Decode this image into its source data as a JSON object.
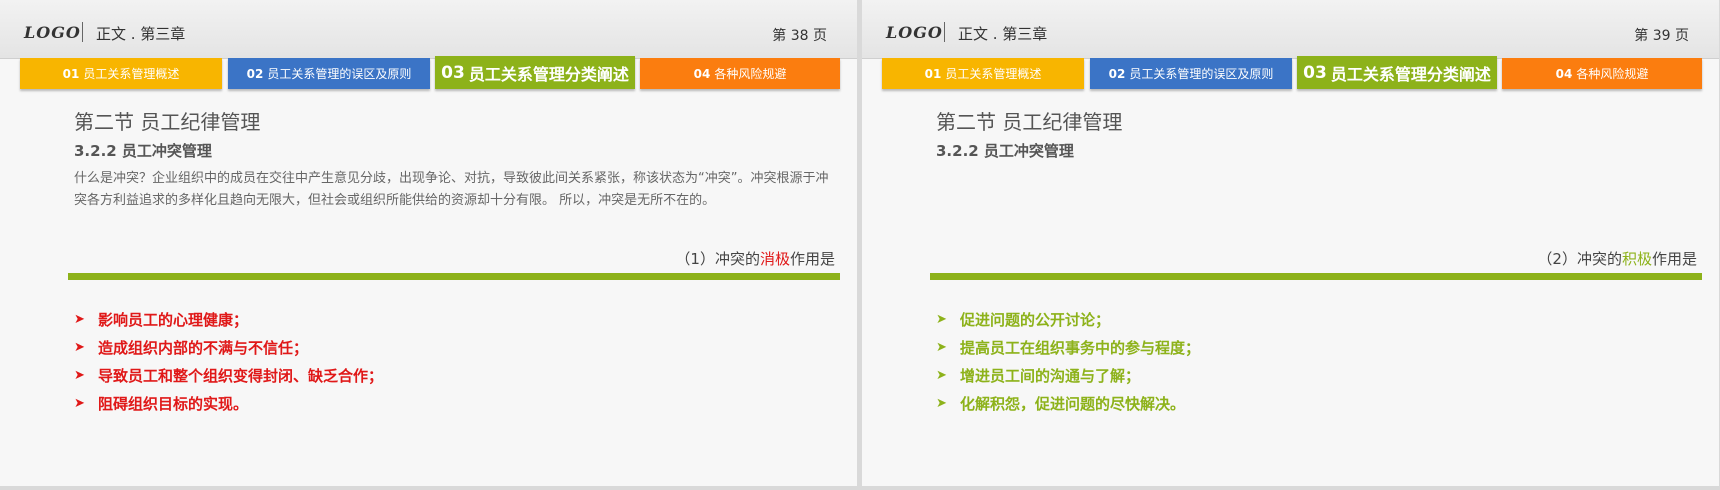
{
  "slides": [
    {
      "logo": "LOGO",
      "chapter": "正文 . 第三章",
      "page": "第 38 页",
      "tabs": [
        {
          "num": "01",
          "label": "员工关系管理概述"
        },
        {
          "num": "02",
          "label": "员工关系管理的误区及原则"
        },
        {
          "num": "03",
          "label": "员工关系管理分类阐述"
        },
        {
          "num": "04",
          "label": "各种风险规避"
        }
      ],
      "section_title": "第二节  员工纪律管理",
      "subsection": "3.2.2 员工冲突管理",
      "body": "什么是冲突？企业组织中的成员在交往中产生意见分歧，出现争论、对抗，导致彼此间关系紧张，称该状态为“冲突”。冲突根源于冲突各方利益追求的多样化且趋向无限大，但社会或组织所能供给的资源却十分有限。  所以，冲突是无所不在的。",
      "role_prefix": "（1）冲突的",
      "role_highlight": "消极",
      "role_suffix": "作用是",
      "bullets": [
        "影响员工的心理健康；",
        "造成组织内部的不满与不信任；",
        "导致员工和整个组织变得封闭、缺乏合作；",
        "阻碍组织目标的实现。"
      ]
    },
    {
      "logo": "LOGO",
      "chapter": "正文 . 第三章",
      "page": "第 39 页",
      "tabs": [
        {
          "num": "01",
          "label": "员工关系管理概述"
        },
        {
          "num": "02",
          "label": "员工关系管理的误区及原则"
        },
        {
          "num": "03",
          "label": "员工关系管理分类阐述"
        },
        {
          "num": "04",
          "label": "各种风险规避"
        }
      ],
      "section_title": "第二节  员工纪律管理",
      "subsection": "3.2.2 员工冲突管理",
      "role_prefix": "（2）冲突的",
      "role_highlight": "积极",
      "role_suffix": "作用是",
      "bullets": [
        "促进问题的公开讨论；",
        "提高员工在组织事务中的参与程度；",
        "增进员工间的沟通与了解；",
        "化解积怨，促进问题的尽快解决。"
      ]
    }
  ],
  "colors": {
    "tab1": "#f8b500",
    "tab2": "#3b74c6",
    "tab3": "#8db21a",
    "tab4": "#fb7d0f",
    "negative": "#e01818",
    "positive": "#8db21a"
  },
  "icons": {
    "bullet": "arrow-right-icon"
  }
}
